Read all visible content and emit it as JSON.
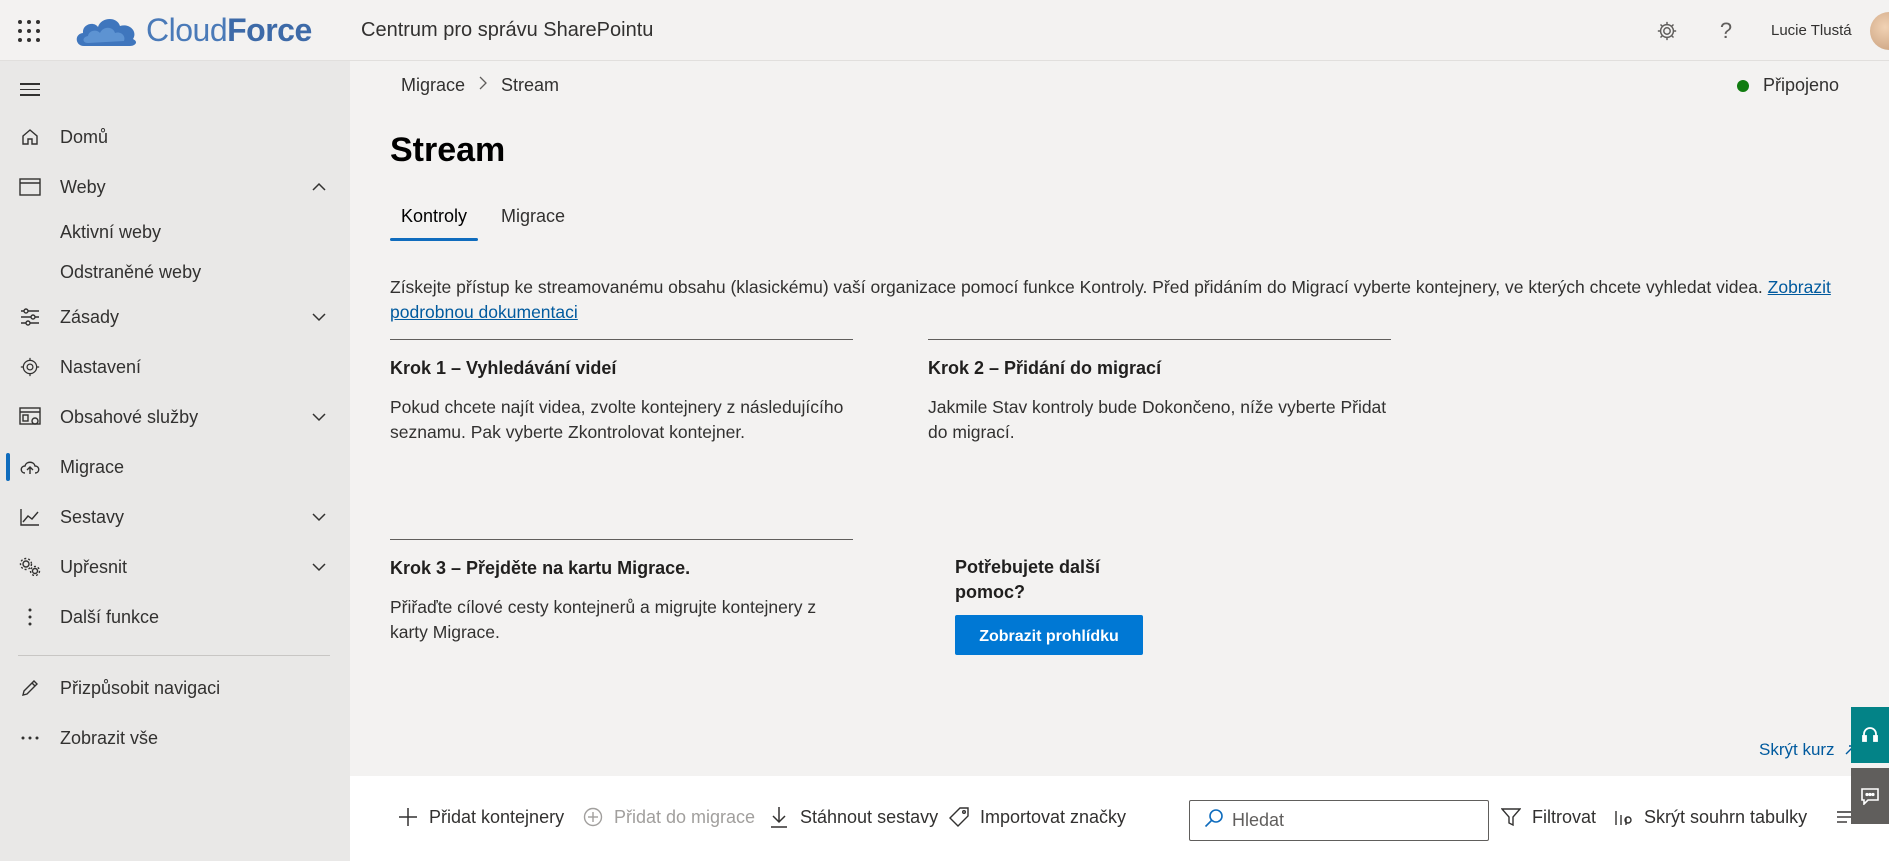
{
  "header": {
    "logo_text_light": "Cloud",
    "logo_text_bold": "Force",
    "app_title": "Centrum pro správu SharePointu",
    "user_name": "Lucie Tlustá"
  },
  "sidebar": {
    "items": [
      {
        "label": "Domů",
        "icon": "home-icon"
      },
      {
        "label": "Weby",
        "icon": "browser-icon"
      },
      {
        "label": "Zásady",
        "icon": "sliders-icon"
      },
      {
        "label": "Nastavení",
        "icon": "gear-icon"
      },
      {
        "label": "Obsahové služby",
        "icon": "content-services-icon"
      },
      {
        "label": "Migrace",
        "icon": "cloud-upload-icon"
      },
      {
        "label": "Sestavy",
        "icon": "chart-line-icon"
      },
      {
        "label": "Upřesnit",
        "icon": "gears-icon"
      },
      {
        "label": "Další funkce",
        "icon": "more-vertical-icon"
      },
      {
        "label": "Přizpůsobit navigaci",
        "icon": "pencil-icon"
      },
      {
        "label": "Zobrazit vše",
        "icon": "more-horizontal-icon"
      }
    ],
    "sub_items": {
      "active_sites": "Aktivní weby",
      "deleted_sites": "Odstraněné weby"
    }
  },
  "breadcrumb": {
    "parent": "Migrace",
    "current": "Stream"
  },
  "status": {
    "label": "Připojeno",
    "color": "#107c10"
  },
  "page": {
    "title": "Stream",
    "tabs": [
      {
        "label": "Kontroly",
        "active": true
      },
      {
        "label": "Migrace",
        "active": false
      }
    ],
    "intro_text": "Získejte přístup ke streamovanému obsahu (klasickému) vaší organizace pomocí funkce Kontroly. Před přidáním do Migrací vyberte kontejnery, ve kterých chcete vyhledat videa. ",
    "intro_link": "Zobrazit podrobnou dokumentaci"
  },
  "steps": [
    {
      "title": "Krok 1 – Vyhledávání videí",
      "body": "Pokud chcete najít videa, zvolte kontejnery z následujícího seznamu. Pak vyberte Zkontrolovat kontejner."
    },
    {
      "title": "Krok 2 – Přidání do migrací",
      "body": "Jakmile Stav kontroly bude Dokončeno, níže vyberte Přidat do migrací."
    },
    {
      "title": "Krok 3 – Přejděte na kartu Migrace.",
      "body": "Přiřaďte cílové cesty kontejnerů a migrujte kontejnery z karty Migrace."
    }
  ],
  "help": {
    "title": "Potřebujete další pomoc?",
    "button": "Zobrazit prohlídku"
  },
  "hide_course": "Skrýt kurz",
  "command_bar": {
    "add_containers": "Přidat kontejnery",
    "add_to_migration": "Přidat do migrace",
    "download_reports": "Stáhnout sestavy",
    "import_tags": "Importovat značky",
    "search_placeholder": "Hledat",
    "filter": "Filtrovat",
    "hide_summary": "Skrýt souhrn tabulky"
  },
  "colors": {
    "accent": "#0f6cbd",
    "button": "#0078d4",
    "help_teal": "#038387",
    "feedback_gray": "#605e5c"
  }
}
